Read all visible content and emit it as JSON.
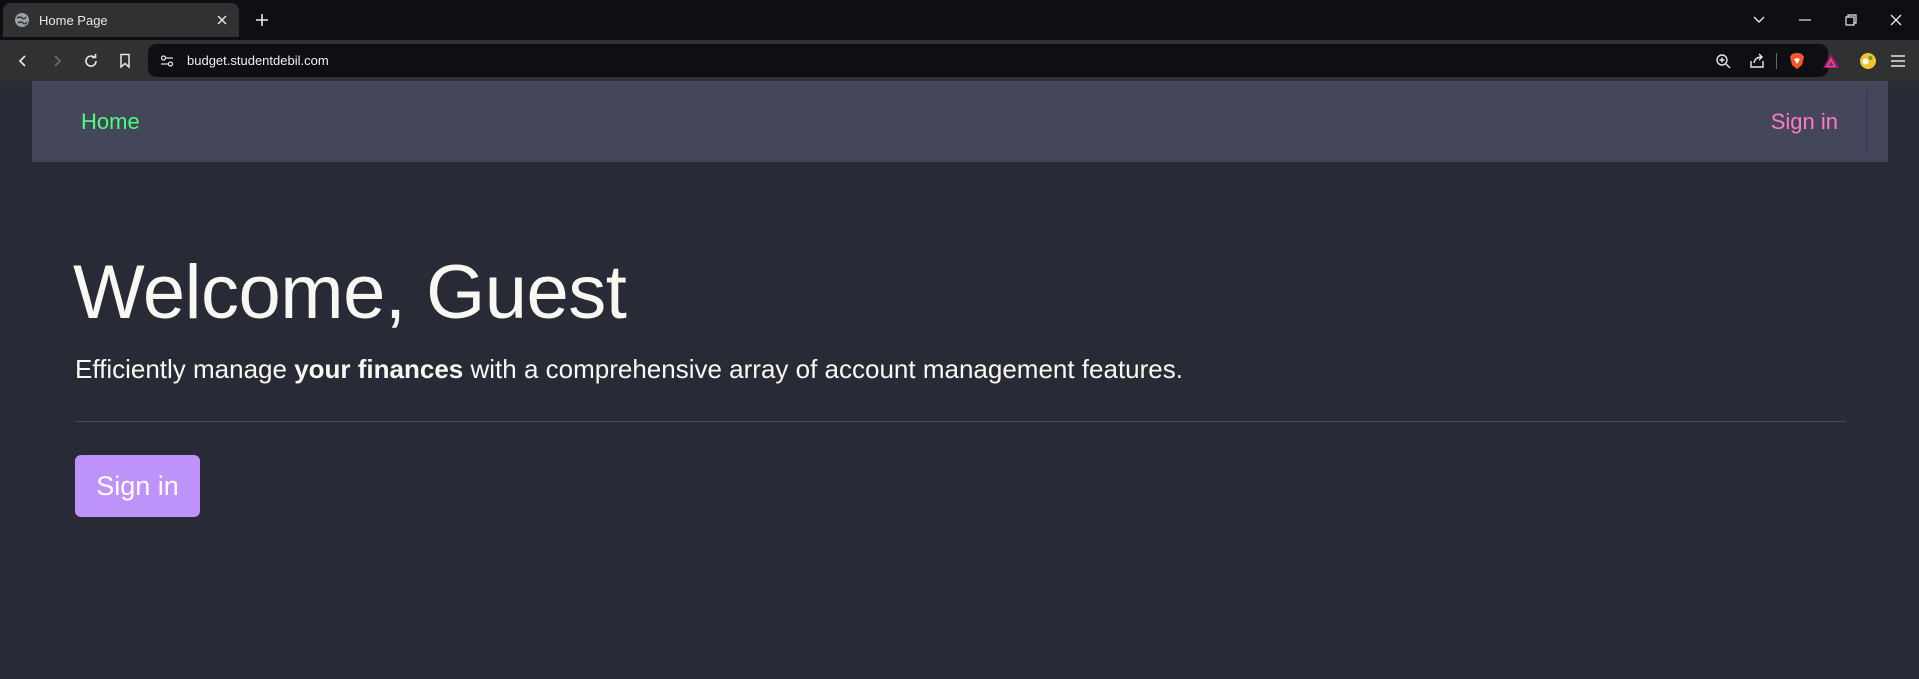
{
  "browser": {
    "tab": {
      "title": "Home Page"
    },
    "url": "budget.studentdebil.com",
    "colors": {
      "brave_accent": "#fb542b"
    }
  },
  "nav": {
    "home_label": "Home",
    "signin_label": "Sign in"
  },
  "hero": {
    "title": "Welcome, Guest",
    "lead_before": "Efficiently manage ",
    "lead_bold": "your finances",
    "lead_after": " with a comprehensive array of account management features.",
    "button_label": "Sign in"
  },
  "theme": {
    "background": "#282a36",
    "navbar": "#44475a",
    "home_link": "#50fa7b",
    "signin_link": "#ff79c6",
    "button": "#bd93f9"
  }
}
